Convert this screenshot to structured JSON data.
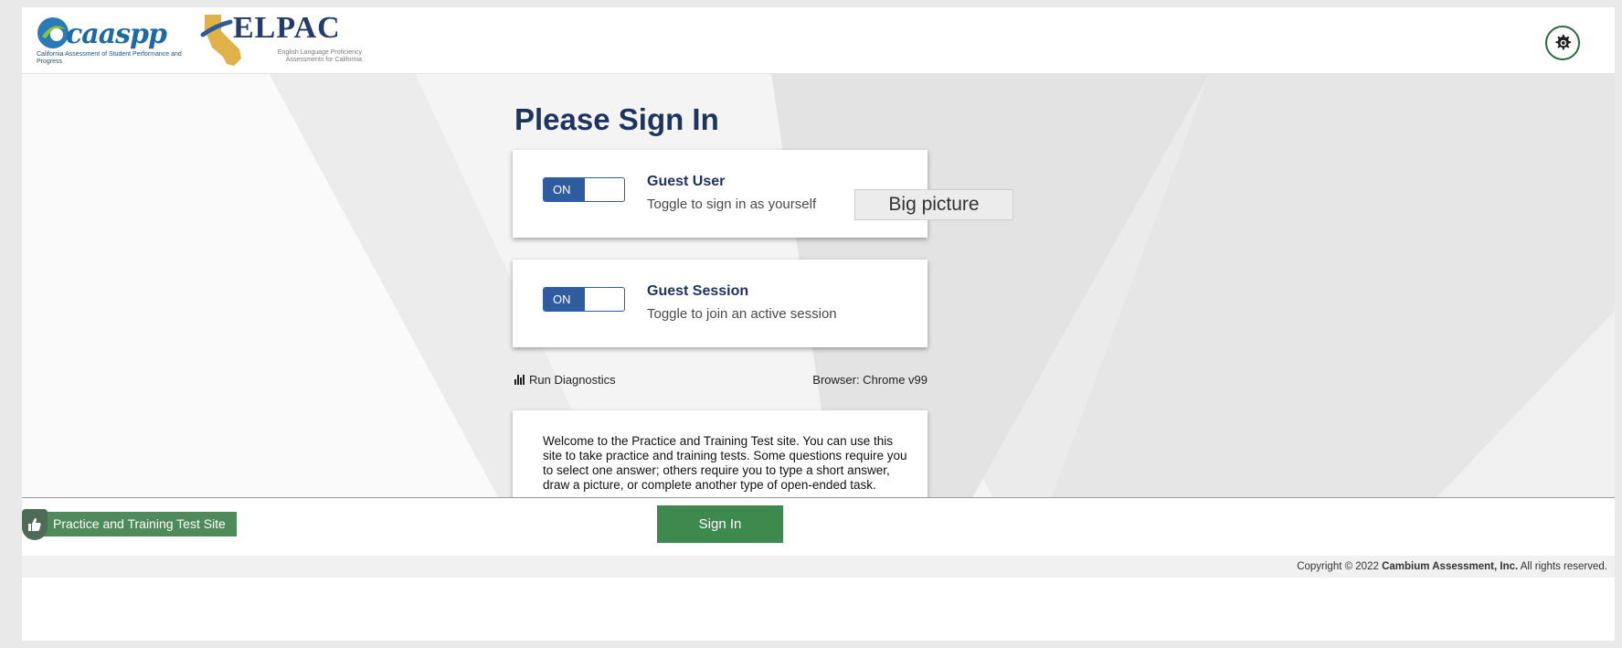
{
  "header": {
    "caaspp_logo_text": "caaspp",
    "caaspp_subtitle": "California Assessment of Student Performance and Progress",
    "elpac_logo_text": "ELPAC",
    "elpac_subtitle": "English Language Proficiency Assessments for California",
    "settings_icon": "gear-icon"
  },
  "main": {
    "title": "Please Sign In",
    "guest_user": {
      "toggle_label": "ON",
      "title": "Guest User",
      "description": "Toggle to sign in as yourself"
    },
    "guest_session": {
      "toggle_label": "ON",
      "title": "Guest Session",
      "description": "Toggle to join an active session"
    },
    "tooltip": "Big picture",
    "diagnostics_label": "Run Diagnostics",
    "diagnostics_icon": "bar-chart-icon",
    "browser_info": "Browser: Chrome v99",
    "welcome_text": "Welcome to the Practice and Training Test site. You can use this site to take practice and training tests. Some questions require you to select one answer; others require you to type a short answer, draw a picture, or complete another type of open-ended task."
  },
  "footer": {
    "site_label": "Practice and Training Test Site",
    "site_icon": "thumbs-up-shield-icon",
    "sign_in_label": "Sign In",
    "copyright_prefix": "Copyright © 2022",
    "copyright_company": "Cambium Assessment, Inc.",
    "copyright_suffix": "All rights reserved."
  },
  "colors": {
    "title": "#1d3461",
    "toggle_on": "#2f5c9e",
    "primary_green": "#3e8a4e",
    "site_badge": "#4f8a5a"
  }
}
